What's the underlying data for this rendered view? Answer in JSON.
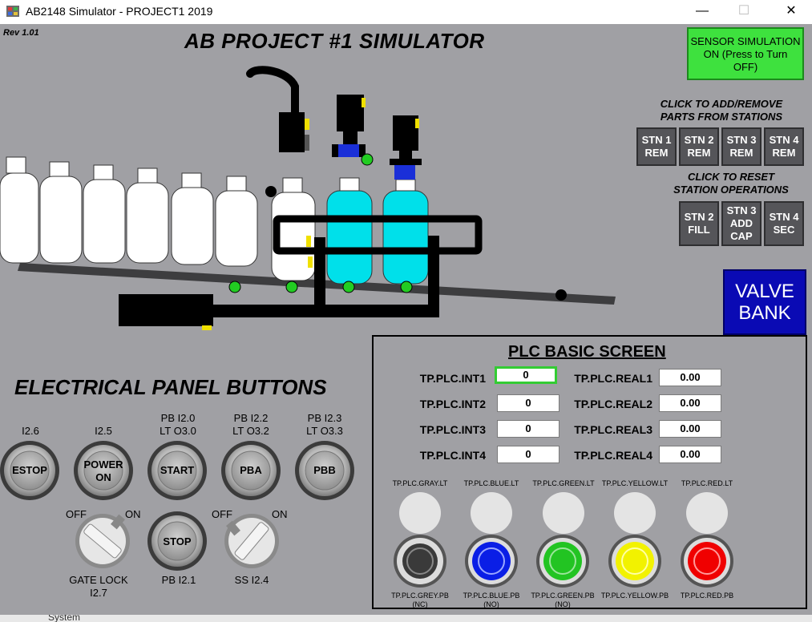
{
  "window": {
    "title": "AB2148 Simulator - PROJECT1 2019",
    "minimize_icon": "minimize-icon",
    "maximize_icon": "maximize-icon",
    "close_icon": "close-icon"
  },
  "header": {
    "rev": "Rev 1.01",
    "title": "AB PROJECT #1 SIMULATOR"
  },
  "sensor_button": {
    "line1": "SENSOR SIMULATION",
    "line2": "ON (Press to Turn",
    "line3": "OFF)",
    "color": "#3ee13e"
  },
  "stations": {
    "remove_caption_1": "CLICK TO ADD/REMOVE",
    "remove_caption_2": "PARTS FROM STATIONS",
    "remove_buttons": [
      {
        "line1": "STN 1",
        "line2": "REM"
      },
      {
        "line1": "STN 2",
        "line2": "REM"
      },
      {
        "line1": "STN 3",
        "line2": "REM"
      },
      {
        "line1": "STN 4",
        "line2": "REM"
      }
    ],
    "reset_caption_1": "CLICK TO RESET",
    "reset_caption_2": "STATION OPERATIONS",
    "reset_buttons": [
      {
        "line1": "STN 2",
        "line2": "FILL",
        "line3": ""
      },
      {
        "line1": "STN 3",
        "line2": "ADD",
        "line3": "CAP"
      },
      {
        "line1": "STN 4",
        "line2": "SEC",
        "line3": ""
      }
    ]
  },
  "valve_bank": {
    "line1": "VALVE",
    "line2": "BANK",
    "color": "#0a0ab4"
  },
  "electrical_panel": {
    "title": "ELECTRICAL PANEL BUTTONS",
    "top_buttons": [
      {
        "label1": "",
        "label2": "I2.6",
        "text1": "ESTOP",
        "text2": ""
      },
      {
        "label1": "",
        "label2": "I2.5",
        "text1": "POWER",
        "text2": "ON"
      },
      {
        "label1": "PB I2.0",
        "label2": "LT O3.0",
        "text1": "START",
        "text2": ""
      },
      {
        "label1": "PB I2.2",
        "label2": "LT O3.2",
        "text1": "PBA",
        "text2": ""
      },
      {
        "label1": "PB I2.3",
        "label2": "LT O3.3",
        "text1": "PBB",
        "text2": ""
      }
    ],
    "gate_lock": {
      "off": "OFF",
      "on": "ON",
      "label1": "GATE LOCK",
      "label2": "I2.7"
    },
    "stop": {
      "text": "STOP",
      "label": "PB I2.1"
    },
    "selector": {
      "off": "OFF",
      "on": "ON",
      "label": "SS I2.4"
    }
  },
  "plc": {
    "title": "PLC BASIC SCREEN",
    "ints": [
      {
        "tag": "TP.PLC.INT1",
        "value": "0"
      },
      {
        "tag": "TP.PLC.INT2",
        "value": "0"
      },
      {
        "tag": "TP.PLC.INT3",
        "value": "0"
      },
      {
        "tag": "TP.PLC.INT4",
        "value": "0"
      }
    ],
    "reals": [
      {
        "tag": "TP.PLC.REAL1",
        "value": "0.00"
      },
      {
        "tag": "TP.PLC.REAL2",
        "value": "0.00"
      },
      {
        "tag": "TP.PLC.REAL3",
        "value": "0.00"
      },
      {
        "tag": "TP.PLC.REAL4",
        "value": "0.00"
      }
    ],
    "lights": [
      {
        "label": "TP.PLC.GRAY.LT"
      },
      {
        "label": "TP.PLC.BLUE.LT"
      },
      {
        "label": "TP.PLC.GREEN.LT"
      },
      {
        "label": "TP.PLC.YELLOW.LT"
      },
      {
        "label": "TP.PLC.RED.LT"
      }
    ],
    "pushbuttons": [
      {
        "label1": "TP.PLC.GREY.PB",
        "label2": "(NC)",
        "color": "#3a3a3a"
      },
      {
        "label1": "TP.PLC.BLUE.PB",
        "label2": "(NO)",
        "color": "#0a1ee6"
      },
      {
        "label1": "TP.PLC.GREEN.PB",
        "label2": "(NO)",
        "color": "#22c422"
      },
      {
        "label1": "TP.PLC.YELLOW.PB",
        "label2": "",
        "color": "#f2f200"
      },
      {
        "label1": "TP.PLC.RED.PB",
        "label2": "",
        "color": "#f00000"
      }
    ]
  },
  "taskbar_partial": "System"
}
